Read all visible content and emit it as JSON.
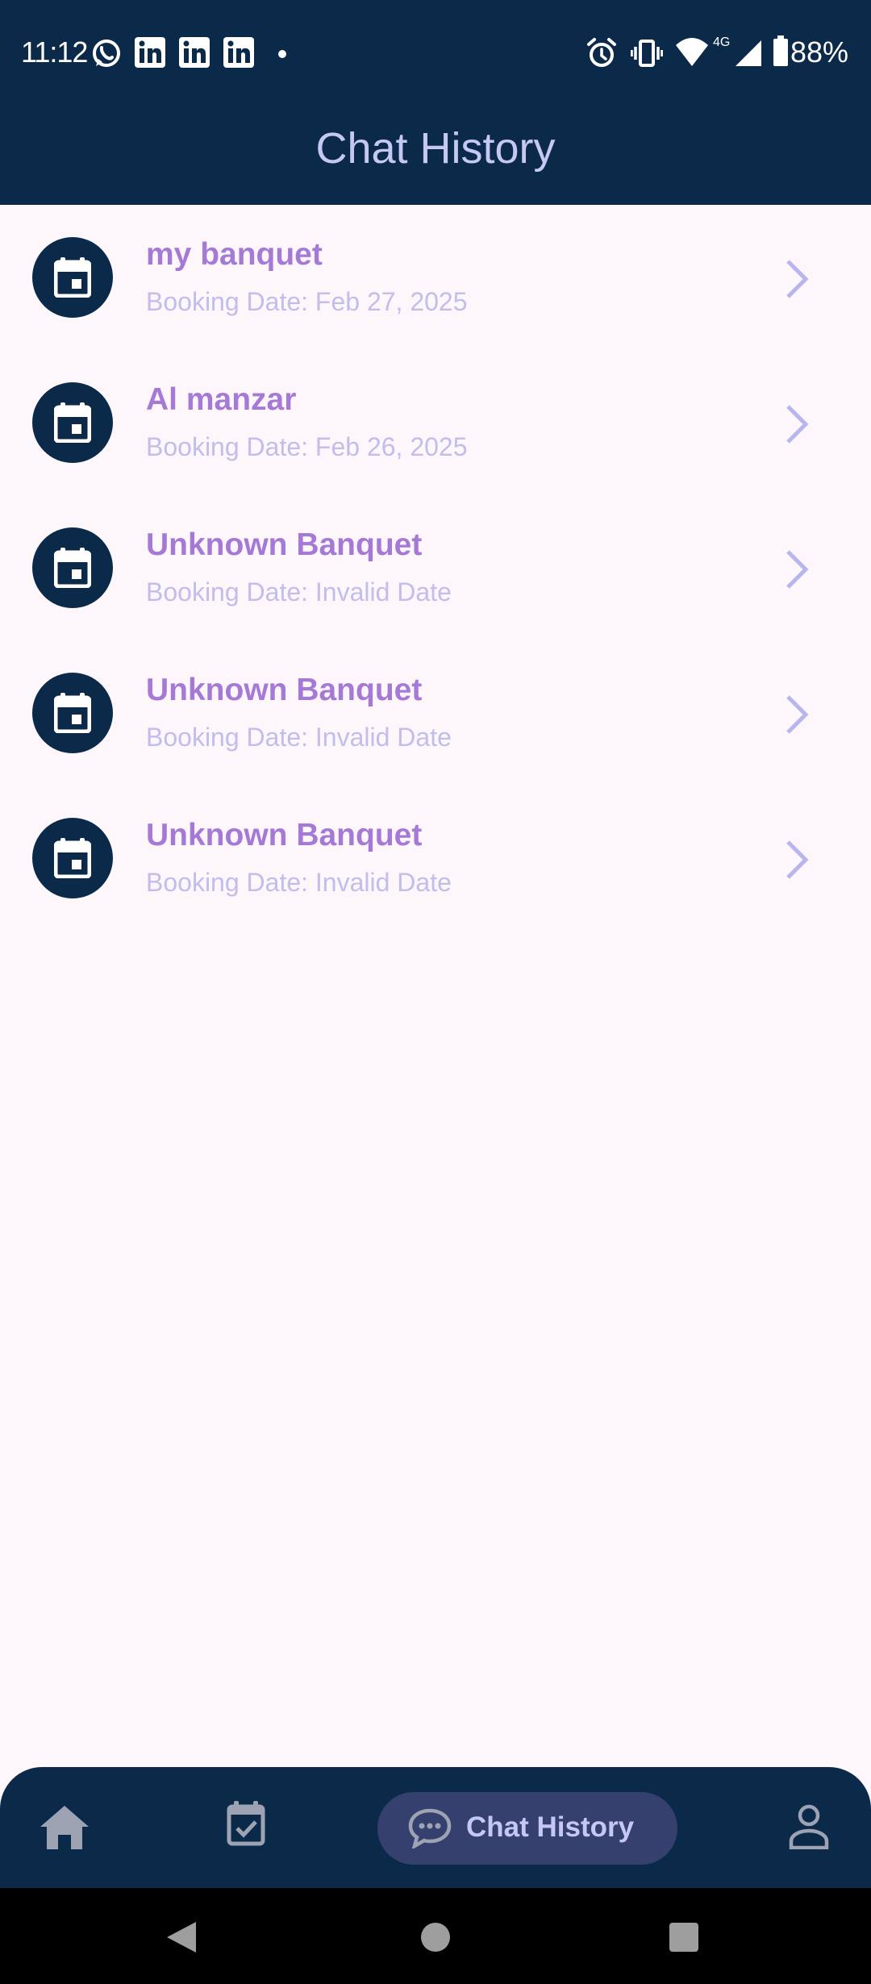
{
  "status_bar": {
    "time": "11:12",
    "battery_text": "88%",
    "network_label": "4G",
    "left_icons": [
      "whatsapp-icon",
      "linkedin-icon",
      "linkedin-icon",
      "linkedin-icon",
      "dot-icon"
    ],
    "right_icons": [
      "alarm-icon",
      "vibrate-icon",
      "wifi-icon",
      "signal-icon",
      "battery-icon"
    ]
  },
  "header": {
    "title": "Chat History"
  },
  "chats": [
    {
      "name": "my banquet",
      "booking_date": "Booking Date: Feb 27, 2025"
    },
    {
      "name": "Al manzar",
      "booking_date": "Booking Date: Feb 26, 2025"
    },
    {
      "name": "Unknown Banquet",
      "booking_date": "Booking Date: Invalid Date"
    },
    {
      "name": "Unknown Banquet",
      "booking_date": "Booking Date: Invalid Date"
    },
    {
      "name": "Unknown Banquet",
      "booking_date": "Booking Date: Invalid Date"
    }
  ],
  "bottom_nav": {
    "items": [
      {
        "icon": "home-icon",
        "label": ""
      },
      {
        "icon": "calendar-check-icon",
        "label": ""
      },
      {
        "icon": "chat-bubble-icon",
        "label": "Chat History",
        "active": true
      },
      {
        "icon": "person-icon",
        "label": ""
      }
    ]
  },
  "colors": {
    "primary_dark": "#0b2a4a",
    "background": "#fdf7fc",
    "title_text": "#c5c8f5",
    "item_name": "#a57ad6",
    "item_date": "#c2bdeb",
    "chevron": "#b9b6ef",
    "nav_active_bg": "#36406e",
    "nav_icon": "#9ea3b3"
  }
}
